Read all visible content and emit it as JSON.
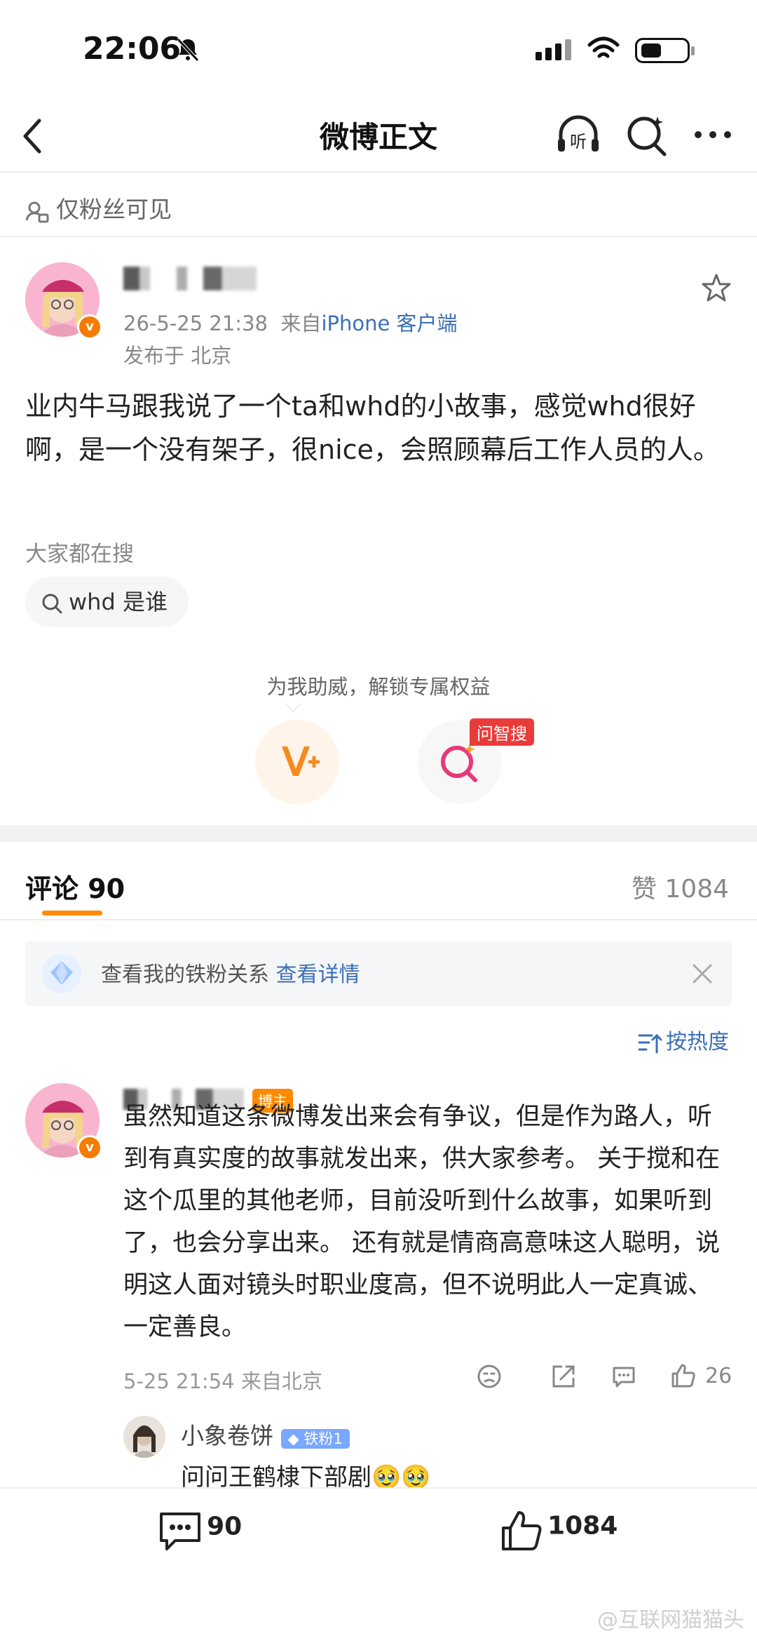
{
  "status_bar": {
    "time": "22:06"
  },
  "nav": {
    "title": "微博正文"
  },
  "visibility": {
    "text": "仅粉丝可见"
  },
  "post": {
    "date": "26-5-25 21:38",
    "source_prefix": "来自",
    "source": "iPhone 客户端",
    "location": "发布于 北京",
    "content": "业内牛马跟我说了一个ta和whd的小故事，感觉whd很好啊，是一个没有架子，很nice，会照顾幕后工作人员的人。"
  },
  "search": {
    "title": "大家都在搜",
    "chip": "whd 是谁"
  },
  "promo": {
    "text": "为我助威，解锁专属权益",
    "ask_tag": "问智搜"
  },
  "comments_header": {
    "tab_label": "评论 90",
    "likes_label": "赞 1084"
  },
  "iron_fan": {
    "text": "查看我的铁粉关系",
    "link": "查看详情"
  },
  "sort": {
    "label": "按热度"
  },
  "comment": {
    "badge": "博主",
    "text": "虽然知道这条微博发出来会有争议，但是作为路人，听到有真实度的故事就发出来，供大家参考。 关于搅和在这个瓜里的其他老师，目前没听到什么故事，如果听到了，也会分享出来。 还有就是情商高意味这人聪明，说明这人面对镜头时职业度高，但不说明此人一定真诚、一定善良。",
    "time": "5-25 21:54 来自北京",
    "likes": "26"
  },
  "reply": {
    "name": "小象卷饼",
    "badge": "铁粉1",
    "text": "问问王鹤棣下部剧🥹🥹"
  },
  "bottom_bar": {
    "comments": "90",
    "likes": "1084"
  },
  "watermark": "@互联网猫猫头",
  "colors": {
    "accent": "#ff8a00",
    "link": "#3a6fb5",
    "verified": "#f57c00"
  }
}
